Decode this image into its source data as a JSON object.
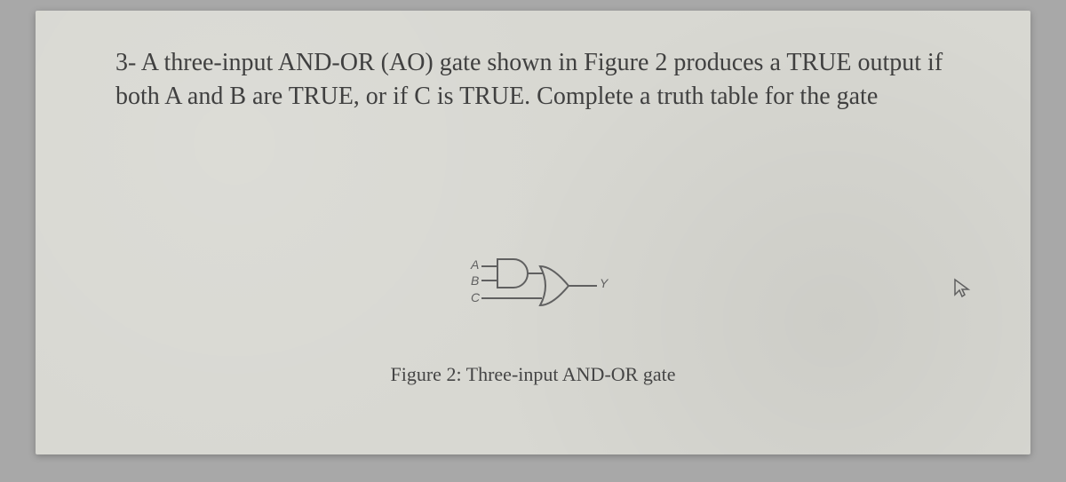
{
  "question": {
    "number": "3-",
    "text": "A three-input AND-OR (AO) gate shown in Figure 2  produces a TRUE output if both A and B are TRUE, or if C is TRUE. Complete a truth table for the gate"
  },
  "figure": {
    "inputs": {
      "a": "A",
      "b": "B",
      "c": "C"
    },
    "output": "Y",
    "caption": "Figure 2: Three-input AND-OR gate"
  }
}
